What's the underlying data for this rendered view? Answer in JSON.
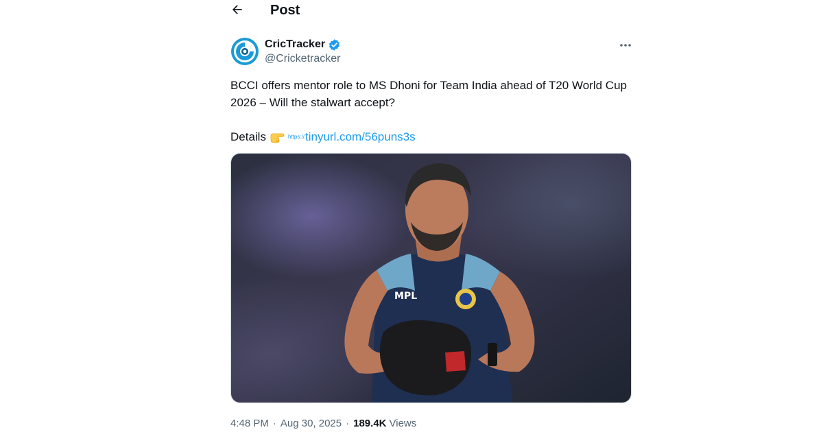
{
  "header": {
    "title": "Post",
    "back_icon": "arrow-left-icon"
  },
  "post": {
    "author": {
      "name": "CricTracker",
      "handle": "@Cricketracker",
      "verified": true,
      "avatar_icon": "crictracker-logo-icon"
    },
    "more_icon": "more-horizontal-icon",
    "text_line": "BCCI offers mentor role to MS Dhoni for Team India ahead of T20 World Cup 2026 – Will the stalwart accept?",
    "details_label": "Details",
    "pointing_emoji_icon": "backhand-index-pointing-right-icon",
    "link_prefix": "https://",
    "link_text": "tinyurl.com/56puns3s",
    "media_alt_icon": "photo-image",
    "time": "4:48 PM",
    "date": "Aug 30, 2025",
    "separator": "·",
    "views_count": "189.4K",
    "views_label": "Views"
  },
  "colors": {
    "text": "#0f1419",
    "secondary": "#536471",
    "link": "#1d9bf0",
    "verified": "#1d9bf0",
    "border": "#cfd9de"
  }
}
